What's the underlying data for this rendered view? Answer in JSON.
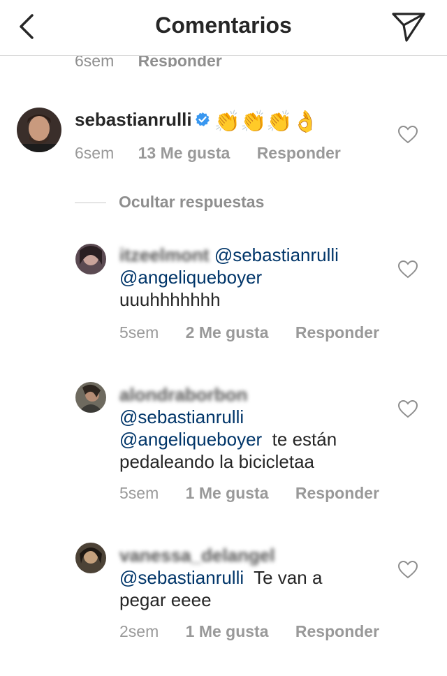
{
  "header": {
    "title": "Comentarios",
    "back_icon": "chevron-left-icon",
    "send_icon": "paper-plane-icon"
  },
  "previous_comment": {
    "time": "6sem",
    "reply_label": "Responder"
  },
  "main_comment": {
    "username": "sebastianrulli",
    "verified": true,
    "emojis": "👏👏👏👌",
    "time": "6sem",
    "likes": "13 Me gusta",
    "reply_label": "Responder"
  },
  "hide_replies_label": "Ocultar respuestas",
  "replies": [
    {
      "username": "itzeelmont",
      "mention_1": "@sebastianrulli",
      "mention_2": "@angeliqueboyer",
      "text": "uuuhhhhhhh",
      "time": "5sem",
      "likes": "2 Me gusta",
      "reply_label": "Responder"
    },
    {
      "username": "alondraborbon",
      "mention_1": "@sebastianrulli",
      "mention_2": "@angeliqueboyer",
      "text_1": "te están",
      "text_2": "pedaleando la bicicletaa",
      "time": "5sem",
      "likes": "1 Me gusta",
      "reply_label": "Responder"
    },
    {
      "username": "vanessa_delangel",
      "mention_1": "@sebastianrulli",
      "text_1": "Te van a",
      "text_2": "pegar eeee",
      "time": "2sem",
      "likes": "1 Me gusta",
      "reply_label": "Responder"
    }
  ],
  "colors": {
    "mention": "#003569",
    "meta": "#999999",
    "verified": "#3897f0"
  }
}
